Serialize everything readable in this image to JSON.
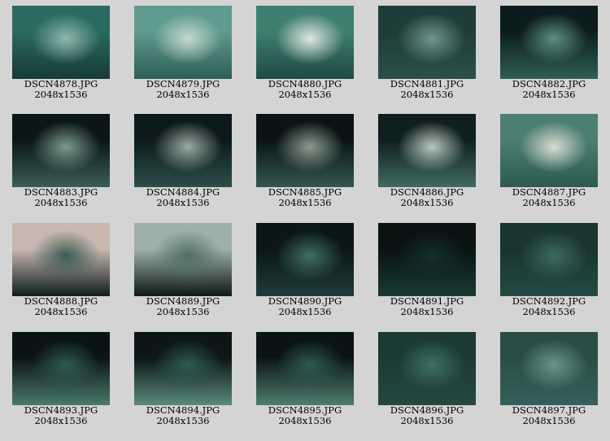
{
  "photos": [
    {
      "name": "DSCN4878.JPG",
      "size": "2048x1536",
      "tone": [
        "#2a6a60",
        "#8fb7ae",
        "#173a36"
      ]
    },
    {
      "name": "DSCN4879.JPG",
      "size": "2048x1536",
      "tone": [
        "#5f9b8e",
        "#c6d8d0",
        "#2e5e55"
      ]
    },
    {
      "name": "DSCN4880.JPG",
      "size": "2048x1536",
      "tone": [
        "#3f7f70",
        "#e0e6e0",
        "#1f4a43"
      ]
    },
    {
      "name": "DSCN4881.JPG",
      "size": "2048x1536",
      "tone": [
        "#203c38",
        "#6f978c",
        "#2b504a"
      ]
    },
    {
      "name": "DSCN4882.JPG",
      "size": "2048x1536",
      "tone": [
        "#0c1c1c",
        "#5f8f80",
        "#2f5e55"
      ]
    },
    {
      "name": "DSCN4883.JPG",
      "size": "2048x1536",
      "tone": [
        "#0b1616",
        "#7d9a90",
        "#3a5e56"
      ]
    },
    {
      "name": "DSCN4884.JPG",
      "size": "2048x1536",
      "tone": [
        "#0c1a1c",
        "#9aaaa0",
        "#2d4e48"
      ]
    },
    {
      "name": "DSCN4885.JPG",
      "size": "2048x1536",
      "tone": [
        "#0a1414",
        "#8c9a90",
        "#34564f"
      ]
    },
    {
      "name": "DSCN4886.JPG",
      "size": "2048x1536",
      "tone": [
        "#0f1e1e",
        "#b9c8c0",
        "#3f6a62"
      ]
    },
    {
      "name": "DSCN4887.JPG",
      "size": "2048x1536",
      "tone": [
        "#4c7e72",
        "#d8dcd2",
        "#2c5a50"
      ]
    },
    {
      "name": "DSCN4888.JPG",
      "size": "2048x1536",
      "tone": [
        "#c8b8b0",
        "#3b5c54",
        "#101c1c"
      ]
    },
    {
      "name": "DSCN4889.JPG",
      "size": "2048x1536",
      "tone": [
        "#9eb0a8",
        "#4f6e66",
        "#0e1818"
      ]
    },
    {
      "name": "DSCN4890.JPG",
      "size": "2048x1536",
      "tone": [
        "#0b1616",
        "#3f6e62",
        "#1f3c38"
      ]
    },
    {
      "name": "DSCN4891.JPG",
      "size": "2048x1536",
      "tone": [
        "#0a1212",
        "#14302c",
        "#1a3a34"
      ]
    },
    {
      "name": "DSCN4892.JPG",
      "size": "2048x1536",
      "tone": [
        "#1a3430",
        "#3d6a5e",
        "#244a42"
      ]
    },
    {
      "name": "DSCN4893.JPG",
      "size": "2048x1536",
      "tone": [
        "#0b1414",
        "#2f5a50",
        "#4a7a6c"
      ]
    },
    {
      "name": "DSCN4894.JPG",
      "size": "2048x1536",
      "tone": [
        "#0c1616",
        "#2f5a50",
        "#5a8a7c"
      ]
    },
    {
      "name": "DSCN4895.JPG",
      "size": "2048x1536",
      "tone": [
        "#0b1414",
        "#2f5a50",
        "#4e7e70"
      ]
    },
    {
      "name": "DSCN4896.JPG",
      "size": "2048x1536",
      "tone": [
        "#1b3a34",
        "#3f7064",
        "#26483f"
      ]
    },
    {
      "name": "DSCN4897.JPG",
      "size": "2048x1536",
      "tone": [
        "#2a4e46",
        "#6a9488",
        "#35605a"
      ]
    }
  ]
}
